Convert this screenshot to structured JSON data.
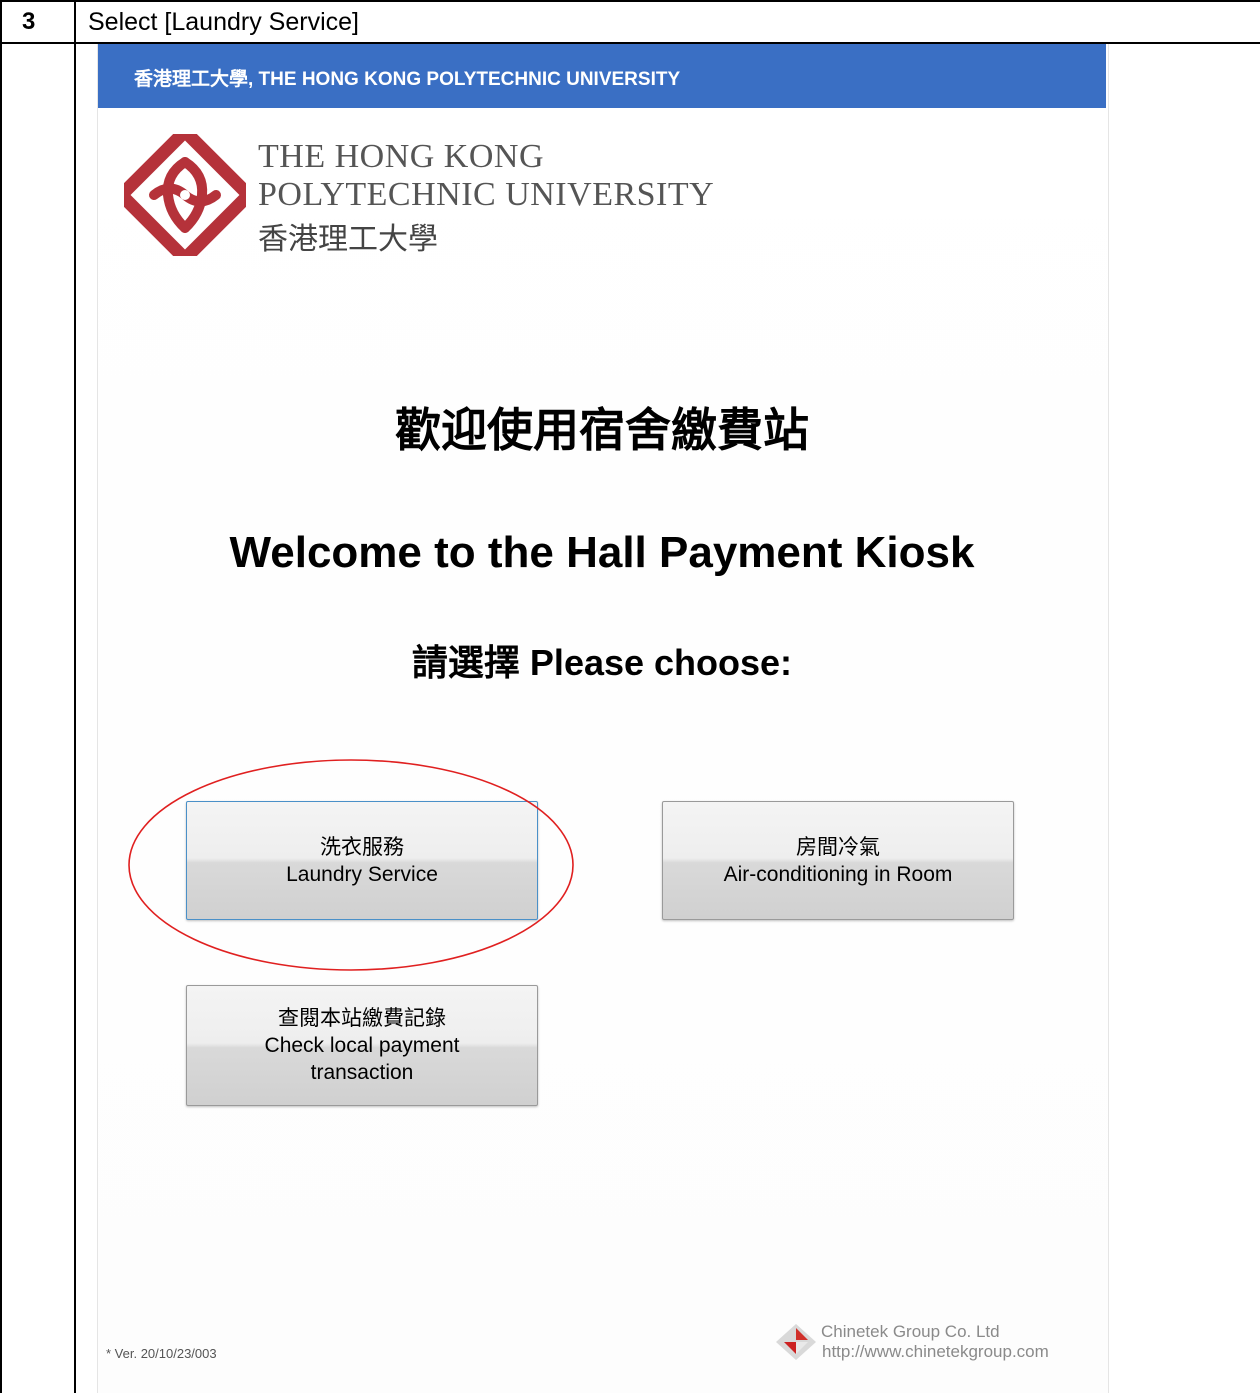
{
  "document": {
    "step_number": "3",
    "instruction": "Select [Laundry Service]"
  },
  "kiosk": {
    "header_text": "香港理工大學, THE HONG KONG POLYTECHNIC UNIVERSITY",
    "logo": {
      "name_en_line1": "THE HONG KONG",
      "name_en_line2": "POLYTECHNIC UNIVERSITY",
      "name_zh": "香港理工大學"
    },
    "welcome_zh": "歡迎使用宿舍繳費站",
    "welcome_en": "Welcome to the Hall Payment Kiosk",
    "choose_prompt": "請選擇 Please choose:",
    "buttons": [
      {
        "label_zh": "洗衣服務",
        "label_en": "Laundry Service",
        "selected": true
      },
      {
        "label_zh": "房間冷氣",
        "label_en": "Air-conditioning in Room"
      },
      {
        "label_zh": "查閱本站繳費記錄",
        "label_en_1": "Check local payment",
        "label_en_2": "transaction"
      }
    ],
    "version": "* Ver. 20/10/23/003",
    "vendor": {
      "name": "Chinetek Group Co. Ltd",
      "url": "http://www.chinetekgroup.com"
    }
  },
  "colors": {
    "header_blue": "#3a6fc4",
    "logo_red": "#b5323a",
    "annotation_red": "#e02020"
  }
}
